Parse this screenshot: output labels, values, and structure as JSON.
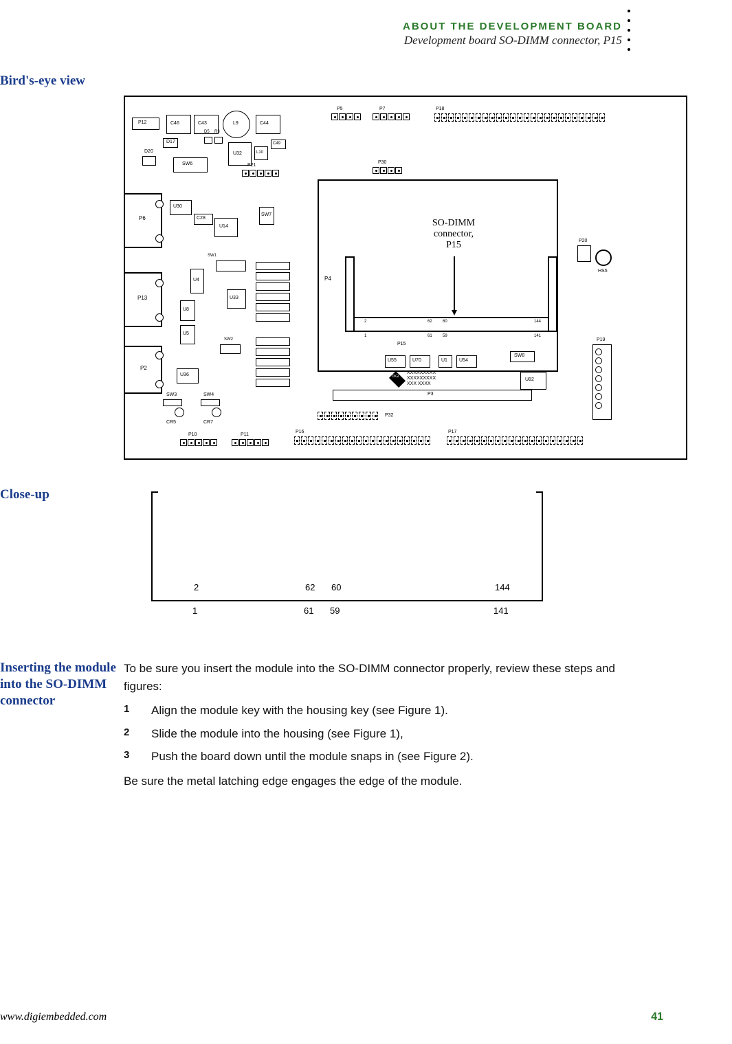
{
  "runningHead": {
    "line1": "ABOUT THE DEVELOPMENT BOARD",
    "line2": "Development board SO-DIMM connector, P15"
  },
  "sections": {
    "birdsEye": "Bird's-eye view",
    "closeUp": "Close-up",
    "inserting": "Inserting the module into the SO-DIMM connector"
  },
  "board": {
    "callout": {
      "l1": "SO-DIMM",
      "l2": "connector,",
      "l3": "P15"
    },
    "refs": {
      "P12": "P12",
      "P6": "P6",
      "P13": "P13",
      "P2": "P2",
      "D17": "D17",
      "D20": "D20",
      "SW6": "SW6",
      "SW7": "SW7",
      "C46": "C46",
      "C43": "C43",
      "L9": "L9",
      "C44": "C44",
      "U32": "U32",
      "L10": "L10",
      "D5": "D5",
      "R3": "R3",
      "C49": "C49",
      "U30": "U30",
      "U14": "U14",
      "C28": "C28",
      "U4": "U4",
      "U8": "U8",
      "U5": "U5",
      "U36": "U36",
      "U33": "U33",
      "SW3": "SW3",
      "SW4": "SW4",
      "CR5": "CR5",
      "CR7": "CR7",
      "SW1": "SW1",
      "SW2": "SW2",
      "P5": "P5",
      "P7": "P7",
      "P18": "P18",
      "P21": "P21",
      "P30": "P30",
      "P4": "P4",
      "P15": "P15",
      "P20": "P20",
      "HS5": "HS5",
      "U55": "U55",
      "U70": "U70",
      "U1": "U1",
      "U54": "U54",
      "SW8": "SW8",
      "U82": "U82",
      "P19": "P19",
      "P3": "P3",
      "P32": "P32",
      "P16": "P16",
      "P17": "P17",
      "P10": "P10",
      "P11": "P11",
      "logoLines": {
        "a": "XXXXXXXXX",
        "b": "XXXXXXXXX",
        "c": "XXX  XXXX"
      },
      "pins": {
        "n2": "2",
        "n62": "62",
        "n60": "60",
        "n144": "144",
        "n141": "141",
        "n61": "61",
        "n59": "59",
        "n1": "1"
      }
    }
  },
  "closeup": {
    "top": {
      "a": "2",
      "b": "62",
      "c": "60",
      "d": "144"
    },
    "bot": {
      "a": "1",
      "b": "61",
      "c": "59",
      "d": "141"
    }
  },
  "inserting": {
    "intro": "To be sure you insert the module into the SO-DIMM connector properly, review these steps and figures:",
    "steps": [
      {
        "n": "1",
        "t": "Align the module key with the housing key (see Figure 1)."
      },
      {
        "n": "2",
        "t": "Slide the module into the housing (see Figure 1),"
      },
      {
        "n": "3",
        "t": "Push the board down until the module snaps in (see Figure 2)."
      }
    ],
    "outro": "Be sure the metal latching edge engages the edge of the module."
  },
  "footer": {
    "url": "www.digiembedded.com",
    "page": "41"
  }
}
